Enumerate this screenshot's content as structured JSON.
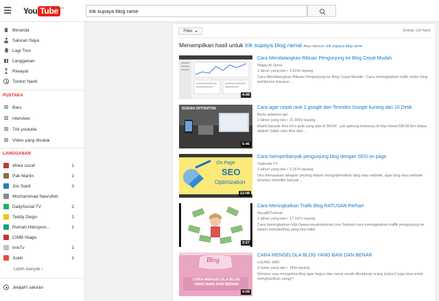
{
  "header": {
    "logo_you": "You",
    "logo_tube": "Tube",
    "logo_reg": "ID",
    "search_value": "trik supaya blog rame"
  },
  "sidebar": {
    "main_items": [
      {
        "label": "Beranda",
        "icon": "home-icon"
      },
      {
        "label": "Saluran Saya",
        "icon": "person-icon"
      },
      {
        "label": "Lagi Tren",
        "icon": "flame-icon"
      },
      {
        "label": "Langganan",
        "icon": "subscriptions-icon"
      },
      {
        "label": "Riwayat",
        "icon": "history-icon"
      },
      {
        "label": "Tonton Nanti",
        "icon": "clock-icon"
      }
    ],
    "library_title": "PUSTAKA",
    "library_items": [
      {
        "label": "Baru"
      },
      {
        "label": "interview"
      },
      {
        "label": "Trik youtube"
      },
      {
        "label": "Video yang disukai"
      }
    ],
    "subs_title": "LANGGANAN",
    "subscriptions": [
      {
        "label": "dhika suzaf",
        "count": "1",
        "color": "#c0392b"
      },
      {
        "label": "Pak Martin",
        "count": "1",
        "color": "#8e6b4a"
      },
      {
        "label": "Jos Siant",
        "count": "3",
        "color": "#2980b9"
      },
      {
        "label": "Mochammad Nasrulloh",
        "count": "",
        "color": "#7f8c8d"
      },
      {
        "label": "DailySocial TV",
        "count": "2",
        "color": "#27ae60"
      },
      {
        "label": "Teddy Diego",
        "count": "1",
        "color": "#f1c40f"
      },
      {
        "label": "Rumah Hidropon...",
        "count": "1",
        "color": "#16a085"
      },
      {
        "label": "CIMB Niaga",
        "count": "",
        "color": "#c0392b"
      },
      {
        "label": "ImkTv",
        "count": "1",
        "color": "#bdc3c7"
      },
      {
        "label": "Jualo",
        "count": "1",
        "color": "#e74c3c"
      }
    ],
    "more_label": "Lebih banyak ›",
    "browse_label": "Jelajahi saluran"
  },
  "main": {
    "filter_label": "Filter",
    "result_count": "Sekitar 118 hasil",
    "spell_prefix": "Menampilkan hasil untuk",
    "spell_q1": "trik supaya blog",
    "spell_q2": "ramai",
    "spell_alt": "Atau telusuri",
    "spell_alt_link": "trik supaya blog rame",
    "results": [
      {
        "title": "Cara Mendatangkan Ribuan Pengunjung ke Blog Cepat Mudah",
        "channel": "Wajay Al Qorni",
        "meta": "1 tahun yang lalu  •  3.914x tayang",
        "desc": "Cara Mendatangkan Ribuan Pengunjung ke Blog Cepat Mudah - Cara meningkatkan trafik visitor blog wordpress maupun ...",
        "duration": "4:49"
      },
      {
        "title": "Cara agar cepat rank 1 google dan Terindex Google kurang dari 10 Detik",
        "channel": "Berto askaono jati",
        "meta": "2 tahun yang lalu  •  21.983x tayang",
        "desc": "Masih banyak ilmu ilmu goib yang ada di SB1M.. yuk gabung kelasnya di http://www.SB1M.Net diatas adalah Salah satu ilmu dari ...",
        "duration": "6:46",
        "thumb_text": "SUDAH DITONTON"
      },
      {
        "title": "Cara memperbanyak pengunjung blog dengan SEO on page",
        "channel": "Taabrofa TV",
        "meta": "1 tahun yang lalu  •  3.157x tayang",
        "desc": "Seo merupakan tahapan penting dalam mengoptimalkan blog atau website, agar blog atau website tersebut memiliki banyak ...",
        "duration": "12:08",
        "thumb_line1": "On Page",
        "thumb_line2": "SEO",
        "thumb_line3": "Optimization"
      },
      {
        "title": "Cara Meningkatkan Trafik Blog RATUSAN Perhari",
        "channel": "NavalMTutorial",
        "meta": "1 tahun yang lalu  •  17.167x tayang",
        "desc": "Cara meningkatkan http://www.navalmtutorial.com Sebuah cara meningkatkan traffik pengunjung ke dalam website/blog yang kita miliki.",
        "duration": "3:27"
      },
      {
        "title": "CARA MENGELOLA BLOG YANG BAIK DAN BENAR",
        "channel": "UJUNG JARI",
        "meta": "9 bulan yang lalu  •  145x tayang",
        "desc": "Gimana cara mengelola blog agar bagus dan ramai sesak dikunjungi orang (sukur2 juga bisa untuk menghasilkan uang)?",
        "duration": "4:09",
        "thumb_word": "Blog",
        "thumb_caption": "CARA MENGELOLA BLOG YANG BAIK DAN BENAR"
      }
    ]
  }
}
